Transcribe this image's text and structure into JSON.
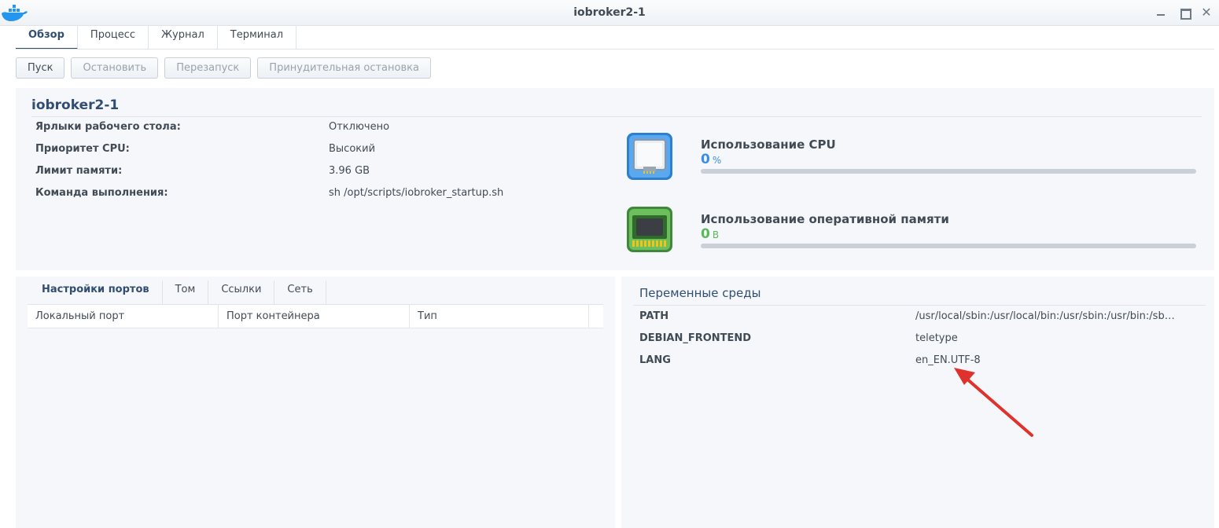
{
  "window": {
    "title": "iobroker2-1"
  },
  "tabs": [
    {
      "label": "Обзор",
      "active": true
    },
    {
      "label": "Процесс"
    },
    {
      "label": "Журнал"
    },
    {
      "label": "Терминал"
    }
  ],
  "toolbar": {
    "start_label": "Пуск",
    "stop_label": "Остановить",
    "restart_label": "Перезапуск",
    "force_stop_label": "Принудительная остановка"
  },
  "overview": {
    "name": "iobroker2-1",
    "rows": [
      {
        "label": "Ярлыки рабочего стола:",
        "value": "Отключено"
      },
      {
        "label": "Приоритет CPU:",
        "value": "Высокий"
      },
      {
        "label": "Лимит памяти:",
        "value": "3.96 GB"
      },
      {
        "label": "Команда выполнения:",
        "value": "sh /opt/scripts/iobroker_startup.sh"
      }
    ],
    "cpu": {
      "label": "Использование CPU",
      "value": "0",
      "unit": "%",
      "color": "#3a8ee6",
      "fill": 0
    },
    "ram": {
      "label": "Использование оперативной памяти",
      "value": "0",
      "unit": "B",
      "color": "#5cb85c",
      "fill": 0
    }
  },
  "ports_panel": {
    "tabs": [
      {
        "label": "Настройки портов",
        "active": true
      },
      {
        "label": "Том"
      },
      {
        "label": "Ссылки"
      },
      {
        "label": "Сеть"
      }
    ],
    "columns": [
      "Локальный порт",
      "Порт контейнера",
      "Тип"
    ]
  },
  "env_panel": {
    "title": "Переменные среды",
    "rows": [
      {
        "key": "PATH",
        "value": "/usr/local/sbin:/usr/local/bin:/usr/sbin:/usr/bin:/sb…"
      },
      {
        "key": "DEBIAN_FRONTEND",
        "value": "teletype"
      },
      {
        "key": "LANG",
        "value": "en_EN.UTF-8"
      }
    ]
  },
  "annotation": {
    "arrow_color": "#e0322d"
  }
}
